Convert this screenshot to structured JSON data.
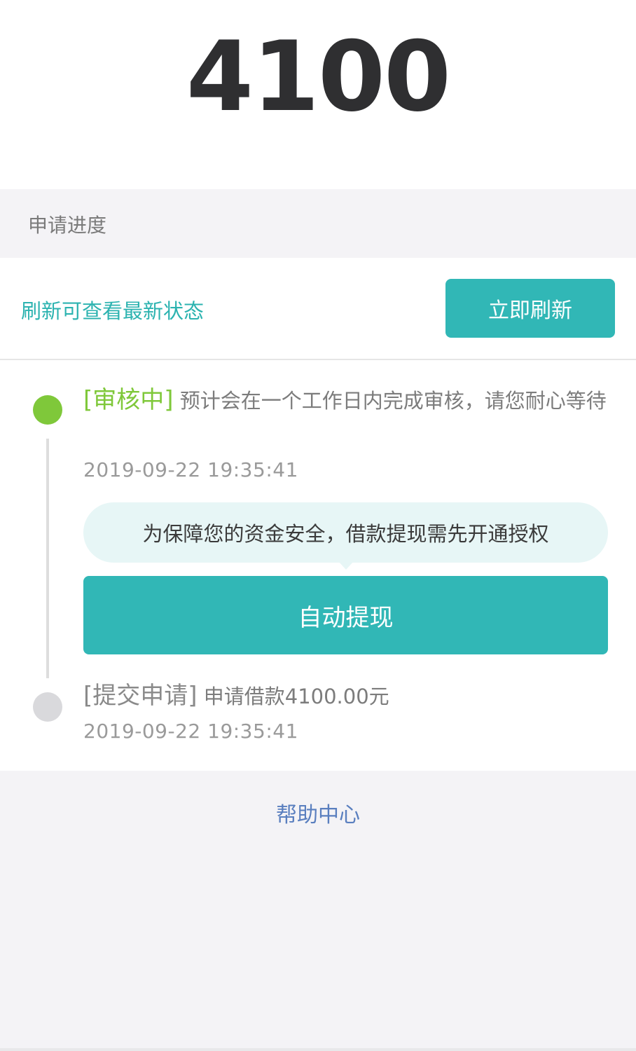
{
  "amount": "4100",
  "progress": {
    "title": "申请进度"
  },
  "refresh": {
    "hint": "刷新可查看最新状态",
    "button_label": "立即刷新"
  },
  "timeline": {
    "step1": {
      "tag": "[审核中]",
      "text": " 预计会在一个工作日内完成审核，请您耐心等待",
      "time": "2019-09-22 19:35:41",
      "tip": "为保障您的资金安全，借款提现需先开通授权",
      "button_label": "自动提现"
    },
    "step2": {
      "tag": "[提交申请]",
      "text": " 申请借款4100.00元",
      "time": "2019-09-22 19:35:41"
    }
  },
  "help": {
    "label": "帮助中心"
  },
  "colors": {
    "accent": "#31b7b6",
    "active": "#7fc83a",
    "link": "#5a7fbf"
  }
}
